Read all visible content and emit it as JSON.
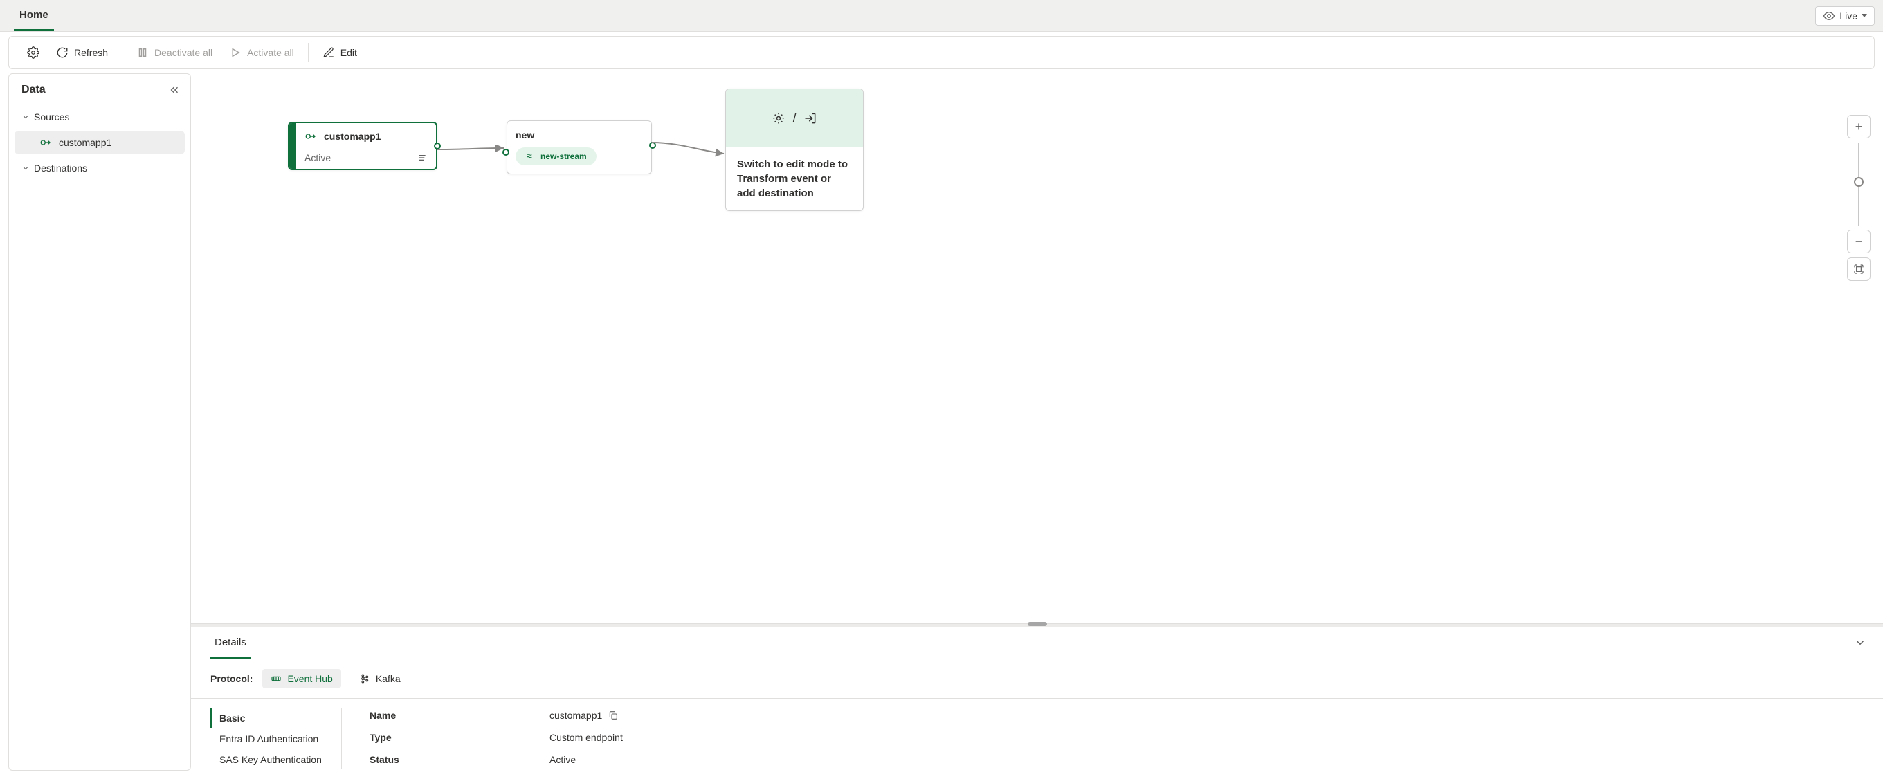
{
  "header": {
    "tab": "Home",
    "live_label": "Live"
  },
  "toolbar": {
    "refresh": "Refresh",
    "deactivate_all": "Deactivate all",
    "activate_all": "Activate all",
    "edit": "Edit"
  },
  "sidebar": {
    "title": "Data",
    "sources_label": "Sources",
    "destinations_label": "Destinations",
    "items": [
      {
        "label": "customapp1"
      }
    ]
  },
  "canvas": {
    "source": {
      "title": "customapp1",
      "status": "Active"
    },
    "transform": {
      "title": "new",
      "stream": "new-stream"
    },
    "destination": {
      "hint": "Switch to edit mode to Transform event or add destination"
    }
  },
  "panel": {
    "tab_label": "Details",
    "protocol_label": "Protocol:",
    "protocols": [
      {
        "label": "Event Hub"
      },
      {
        "label": "Kafka"
      }
    ],
    "nav": [
      "Basic",
      "Entra ID Authentication",
      "SAS Key Authentication"
    ],
    "rows": [
      {
        "key": "Name",
        "value": "customapp1",
        "copy": true
      },
      {
        "key": "Type",
        "value": "Custom endpoint",
        "copy": false
      },
      {
        "key": "Status",
        "value": "Active",
        "copy": false
      }
    ]
  }
}
